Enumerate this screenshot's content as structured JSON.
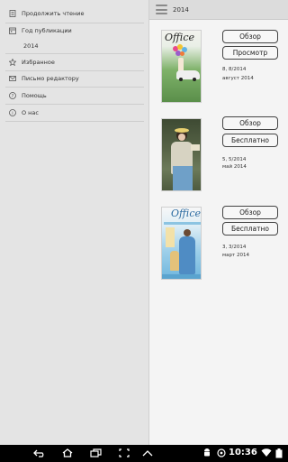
{
  "drawer": {
    "items": [
      {
        "label": "Продолжить чтение",
        "icon": "book-icon"
      },
      {
        "label": "Год публикации",
        "icon": "calendar-icon"
      },
      {
        "label": "Избранное",
        "icon": "star-icon"
      },
      {
        "label": "Письмо редактору",
        "icon": "envelope-icon"
      },
      {
        "label": "Помощь",
        "icon": "help-icon"
      },
      {
        "label": "О нас",
        "icon": "info-icon"
      }
    ],
    "sub_year": "2014"
  },
  "topbar": {
    "title": "2014"
  },
  "issues": [
    {
      "number": "8, 8/2014",
      "date": "август 2014",
      "btn1": "Обзор",
      "btn2": "Просмотр",
      "cover_logo": "Office"
    },
    {
      "number": "5, 5/2014",
      "date": "май 2014",
      "btn1": "Обзор",
      "btn2": "Бесплатно",
      "cover_logo": ""
    },
    {
      "number": "3, 3/2014",
      "date": "март 2014",
      "btn1": "Обзор",
      "btn2": "Бесплатно",
      "cover_logo": "Office"
    }
  ],
  "statusbar": {
    "time": "10:36"
  }
}
